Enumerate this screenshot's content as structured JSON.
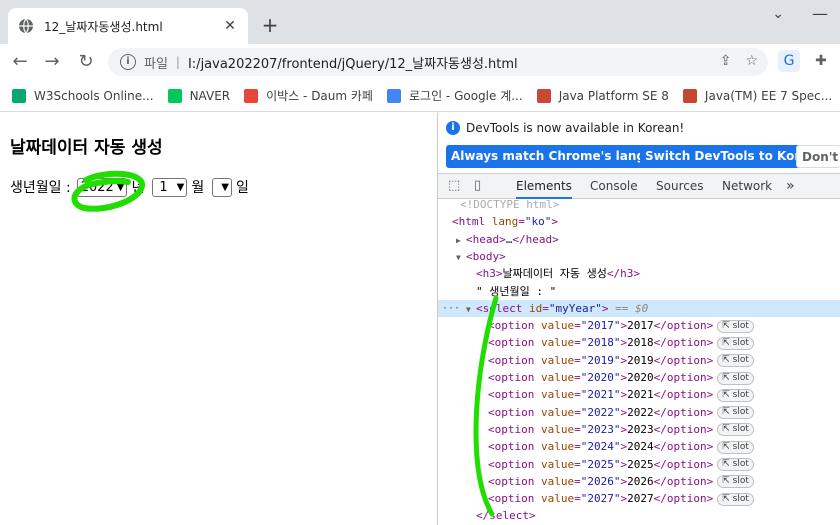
{
  "browser": {
    "tab_title": "12_날짜자동생성.html",
    "tab_close": "✕",
    "new_tab": "+",
    "address": {
      "scheme_label": "파일",
      "url": "I:/java202207/frontend/jQuery/12_날짜자동생성.html"
    },
    "bookmarks": [
      {
        "label": "W3Schools Online...",
        "icon": "w3schools-icon",
        "color": "#04aa6d"
      },
      {
        "label": "NAVER",
        "icon": "naver-icon",
        "color": "#03c75a"
      },
      {
        "label": "이박스 - Daum 카페",
        "icon": "daum-cafe-icon",
        "color": "#e8463a"
      },
      {
        "label": "로그인 - Google 계...",
        "icon": "google-icon",
        "color": "#4285f4"
      },
      {
        "label": "Java Platform SE 8",
        "icon": "oracle-icon",
        "color": "#c74634"
      },
      {
        "label": "Java(TM) EE 7 Spec...",
        "icon": "oracle-icon",
        "color": "#c74634"
      }
    ]
  },
  "page": {
    "heading": "날짜데이터 자동 생성",
    "label_prefix": "생년월일 :",
    "year_value": "2022",
    "year_suffix": "년",
    "month_value": "1",
    "month_suffix": "월",
    "day_value": "",
    "day_suffix": "일"
  },
  "devtools": {
    "info_message": "DevTools is now available in Korean!",
    "btn_match": "Always match Chrome's language",
    "btn_switch": "Switch DevTools to Korean",
    "btn_dont": "Don't s",
    "tabs": [
      "Elements",
      "Console",
      "Sources",
      "Network"
    ],
    "active_tab": "Elements",
    "more_tabs": "»",
    "dom": {
      "doctype": "<!DOCTYPE html>",
      "html_lang": "ko",
      "head_collapsed": "…",
      "h3_text": "날짜데이터 자동 생성",
      "text_node": "\" 생년월일 : \"",
      "select_id": "myYear",
      "selected_marker": "== $0",
      "slot_label": "slot",
      "options": [
        "2017",
        "2018",
        "2019",
        "2020",
        "2021",
        "2022",
        "2023",
        "2024",
        "2025",
        "2026",
        "2027"
      ]
    }
  },
  "colors": {
    "accent": "#1a73e8",
    "annotation_green": "#22dd00"
  }
}
